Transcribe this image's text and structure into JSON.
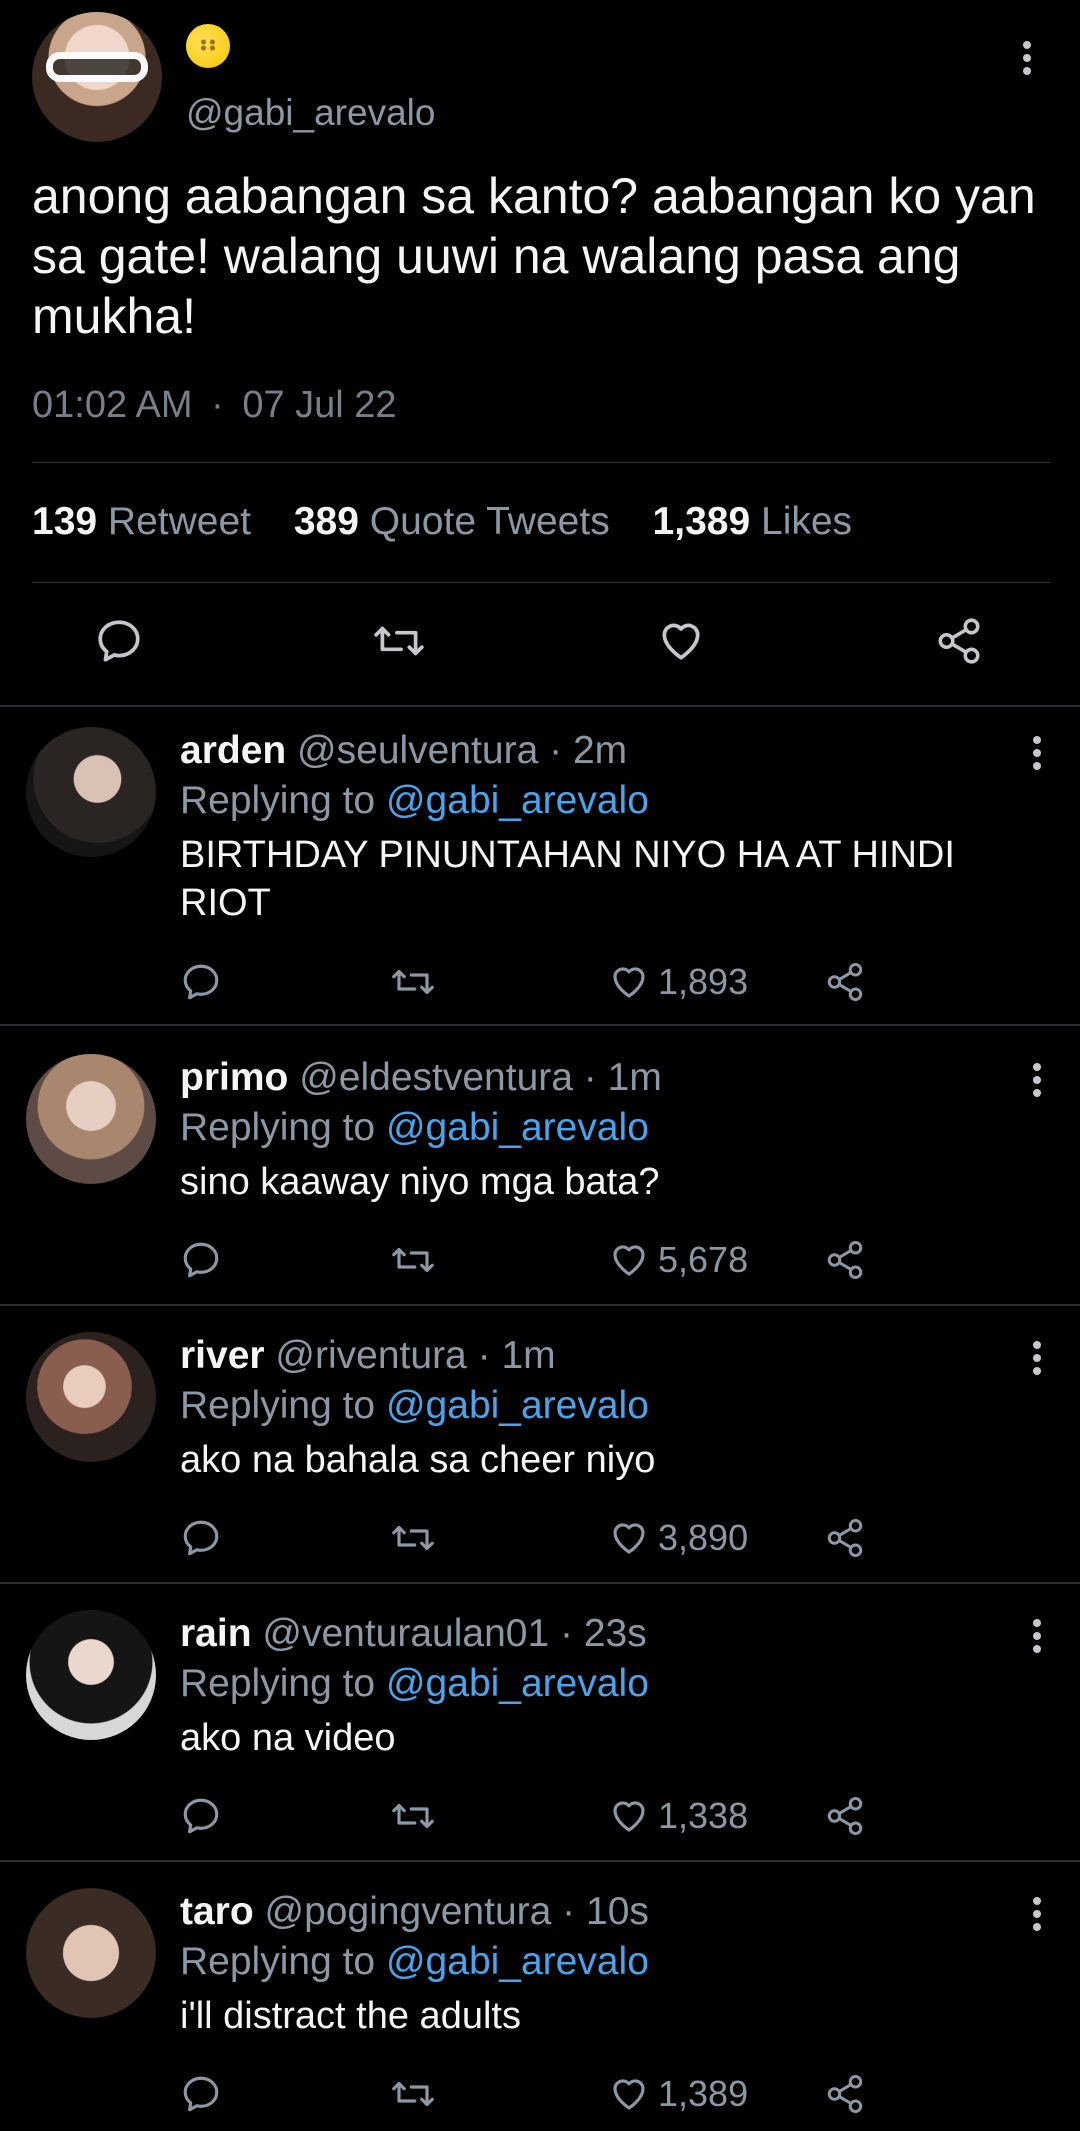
{
  "main_tweet": {
    "handle": "@gabi_arevalo",
    "text": "anong aabangan sa kanto? aabangan ko yan sa gate! walang uuwi na walang pasa ang mukha!",
    "time": "01:02 AM",
    "separator": "·",
    "date": "07 Jul 22",
    "retweets_count": "139",
    "retweets_label": "Retweet",
    "quotes_count": "389",
    "quotes_label": "Quote Tweets",
    "likes_count": "1,389",
    "likes_label": "Likes",
    "icons": {
      "reply": "reply-icon",
      "retweet": "retweet-icon",
      "like": "heart-icon",
      "share": "share-icon",
      "more": "more-icon"
    }
  },
  "replies": [
    {
      "name": "arden",
      "handle": "@seulventura",
      "sep": "·",
      "time": "2m",
      "replying_prefix": "Replying to",
      "replying_to": "@gabi_arevalo",
      "text": "BIRTHDAY PINUNTAHAN NIYO HA AT HINDI RIOT",
      "likes": "1,893"
    },
    {
      "name": "primo",
      "handle": "@eldestventura",
      "sep": "·",
      "time": "1m",
      "replying_prefix": "Replying to",
      "replying_to": "@gabi_arevalo",
      "text": "sino kaaway niyo mga bata?",
      "likes": "5,678"
    },
    {
      "name": "river",
      "handle": "@riventura",
      "sep": "·",
      "time": "1m",
      "replying_prefix": "Replying to",
      "replying_to": "@gabi_arevalo",
      "text": "ako na bahala sa cheer niyo",
      "likes": "3,890"
    },
    {
      "name": "rain",
      "handle": "@venturaulan01",
      "sep": "·",
      "time": "23s",
      "replying_prefix": "Replying to",
      "replying_to": "@gabi_arevalo",
      "text": "ako na video",
      "likes": "1,338"
    },
    {
      "name": "taro",
      "handle": "@pogingventura",
      "sep": "·",
      "time": "10s",
      "replying_prefix": "Replying to",
      "replying_to": "@gabi_arevalo",
      "text": "i'll distract the adults",
      "likes": "1,389"
    }
  ],
  "colors": {
    "background": "#000000",
    "text": "#e7e9ea",
    "muted": "#8b98a5",
    "link": "#4aa4ec",
    "divider": "#2f3336"
  }
}
